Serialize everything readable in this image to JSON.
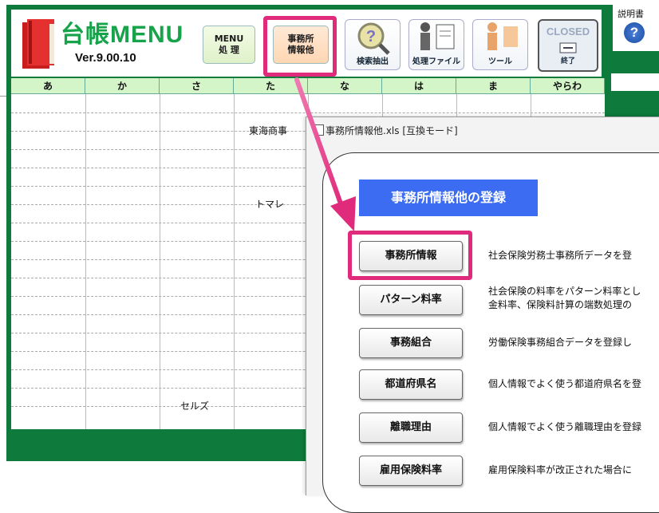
{
  "app": {
    "title": "台帳MENU",
    "version": "Ver.9.00.10"
  },
  "toolbar": {
    "menu_line1": "MENU",
    "menu_line2": "処 理",
    "office_line1": "事務所",
    "office_line2": "情報他",
    "search_label": "検索抽出",
    "files_label": "処理ファイル",
    "tools_label": "ツール",
    "closed_label": "CLOSED",
    "closed_sub": "終了"
  },
  "help": {
    "label": "説明書",
    "icon": "help-icon"
  },
  "kana_columns": [
    "あ",
    "か",
    "さ",
    "た",
    "な",
    "は",
    "ま",
    "やらわ"
  ],
  "cells": {
    "company1": "東海商事",
    "company2": "トマレ",
    "company3": "セルズ"
  },
  "dialog": {
    "title": "事務所情報他.xls [互換モード]",
    "heading": "事務所情報他の登録",
    "options": [
      {
        "label": "事務所情報",
        "desc1": "社会保険労務士事務所データを登",
        "desc2": ""
      },
      {
        "label": "パターン料率",
        "desc1": "社会保険の料率をパターン料率とし",
        "desc2": "金料率、保険料計算の端数処理の"
      },
      {
        "label": "事務組合",
        "desc1": "労働保険事務組合データを登録し",
        "desc2": ""
      },
      {
        "label": "都道府県名",
        "desc1": "個人情報でよく使う都道府県名を登",
        "desc2": ""
      },
      {
        "label": "離職理由",
        "desc1": "個人情報でよく使う離職理由を登録",
        "desc2": ""
      },
      {
        "label": "雇用保険料率",
        "desc1": "雇用保険料率が改正された場合に",
        "desc2": ""
      }
    ]
  },
  "colors": {
    "sheet_green": "#0e7a3c",
    "highlight": "#e02a7b",
    "heading_blue": "#3b6cf2"
  }
}
